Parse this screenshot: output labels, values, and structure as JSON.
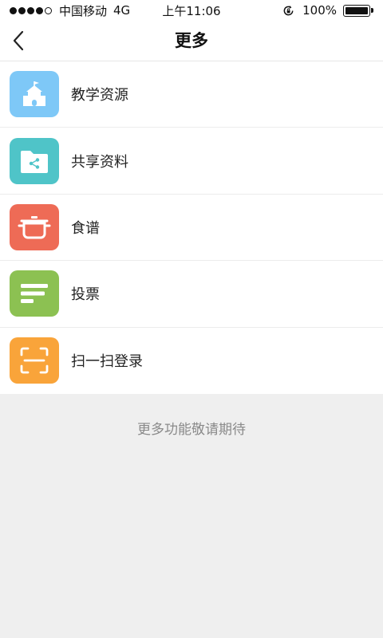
{
  "status_bar": {
    "carrier": "中国移动",
    "network": "4G",
    "time": "上午11:06",
    "battery": "100%",
    "battery_level": 1.0,
    "signal_strength": 4
  },
  "nav": {
    "title": "更多",
    "back_icon": "chevron-left-icon"
  },
  "menu": {
    "items": [
      {
        "label": "教学资源",
        "icon": "school-icon",
        "color": "#7ec8f7"
      },
      {
        "label": "共享资料",
        "icon": "shared-folder-icon",
        "color": "#4fc4c8"
      },
      {
        "label": "食谱",
        "icon": "cooking-pot-icon",
        "color": "#ee6b56"
      },
      {
        "label": "投票",
        "icon": "vote-list-icon",
        "color": "#8cc152"
      },
      {
        "label": "扫一扫登录",
        "icon": "scan-icon",
        "color": "#f9a43a"
      }
    ]
  },
  "footer": {
    "note": "更多功能敬请期待"
  }
}
